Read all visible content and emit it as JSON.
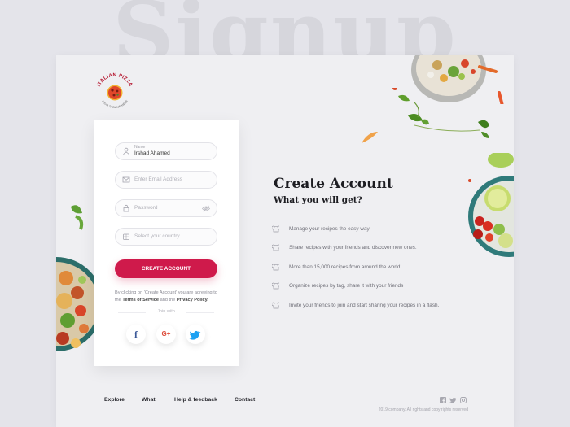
{
  "background_word": "Signup",
  "brand": {
    "name": "ITALIAN PIZZA",
    "tagline": "YOUR TAGLINE HERE"
  },
  "form": {
    "name_label": "Name",
    "name_value": "Irshad Ahamed",
    "email_placeholder": "Enter Email Address",
    "password_placeholder": "Password",
    "country_placeholder": "Select your country",
    "submit_label": "CREATE ACCOUNT",
    "agree_prefix": "By clicking on 'Create Account' you are agreeing to the",
    "terms_link": "Terms of Service",
    "agree_and": "and the",
    "privacy_link": "Privacy Policy.",
    "join_with": "Join with",
    "social": [
      {
        "name": "facebook",
        "glyph": "f",
        "color": "#3b5998"
      },
      {
        "name": "google-plus",
        "glyph": "G+",
        "color": "#dd4b39"
      },
      {
        "name": "twitter",
        "glyph": "t",
        "color": "#1da1f2"
      }
    ]
  },
  "info": {
    "title": "Create Account",
    "subtitle": "What you will get?",
    "benefits": [
      "Manage your recipes the easy way",
      "Share recipes with your friends and discover new ones.",
      "More than 15,000 recipes from around the world!",
      "Organize recipes by tag, share it with your friends",
      "Invite your friends to join and start sharing your recipes in a flash."
    ]
  },
  "footer": {
    "nav": [
      "Explore",
      "What",
      "Help & feedback",
      "Contact"
    ],
    "copyright": "2019 company. All rights and copy rights reserved",
    "social_icons": [
      "facebook-icon",
      "twitter-icon",
      "instagram-icon"
    ]
  },
  "colors": {
    "accent": "#cf1a4b",
    "page_bg": "#e4e4ea",
    "card_bg": "#efeff2"
  }
}
